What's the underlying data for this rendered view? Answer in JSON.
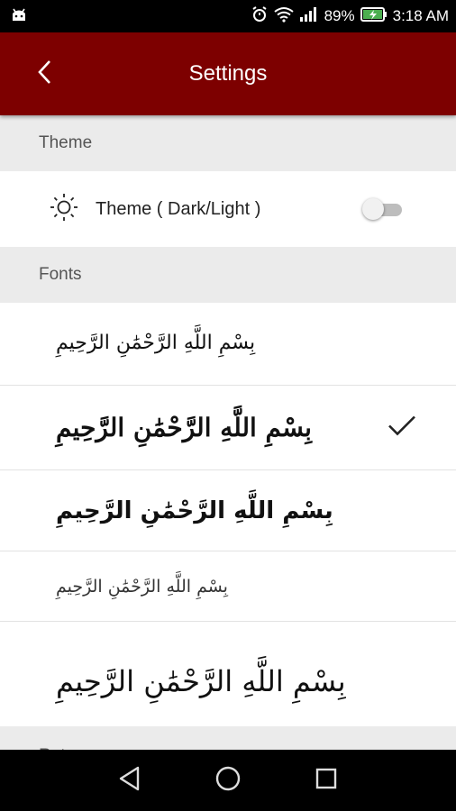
{
  "status_bar": {
    "battery_percent": "89%",
    "time": "3:18 AM",
    "icons": [
      "android-debug-icon",
      "alarm-icon",
      "wifi-icon",
      "signal-icon",
      "battery-charging-icon"
    ]
  },
  "app_bar": {
    "title": "Settings",
    "back_icon": "chevron-left-icon",
    "color": "#7d0000"
  },
  "sections": {
    "theme": {
      "header": "Theme",
      "item_label": "Theme ( Dark/Light )",
      "item_icon": "sun-icon",
      "toggle_on": false
    },
    "fonts": {
      "header": "Fonts",
      "items": [
        {
          "text": "بِسْمِ اللَّهِ الرَّحْمَٰنِ الرَّحِيمِ",
          "selected": false
        },
        {
          "text": "بِسْمِ اللَّهِ الرَّحْمَٰنِ الرَّحِيمِ",
          "selected": true
        },
        {
          "text": "بِسْمِ اللَّهِ الرَّحْمَٰنِ الرَّحِيمِ",
          "selected": false
        },
        {
          "text": "بِسْمِ اللَّهِ الرَّحْمَٰنِ الرَّحِيمِ",
          "selected": false
        },
        {
          "text": "بِسْمِ اللَّهِ الرَّحْمَٰنِ الرَّحِيمِ",
          "selected": false
        }
      ]
    },
    "next": {
      "header": "Rate"
    }
  },
  "nav_bar": {
    "buttons": [
      "back-triangle-icon",
      "home-circle-icon",
      "recents-square-icon"
    ]
  }
}
